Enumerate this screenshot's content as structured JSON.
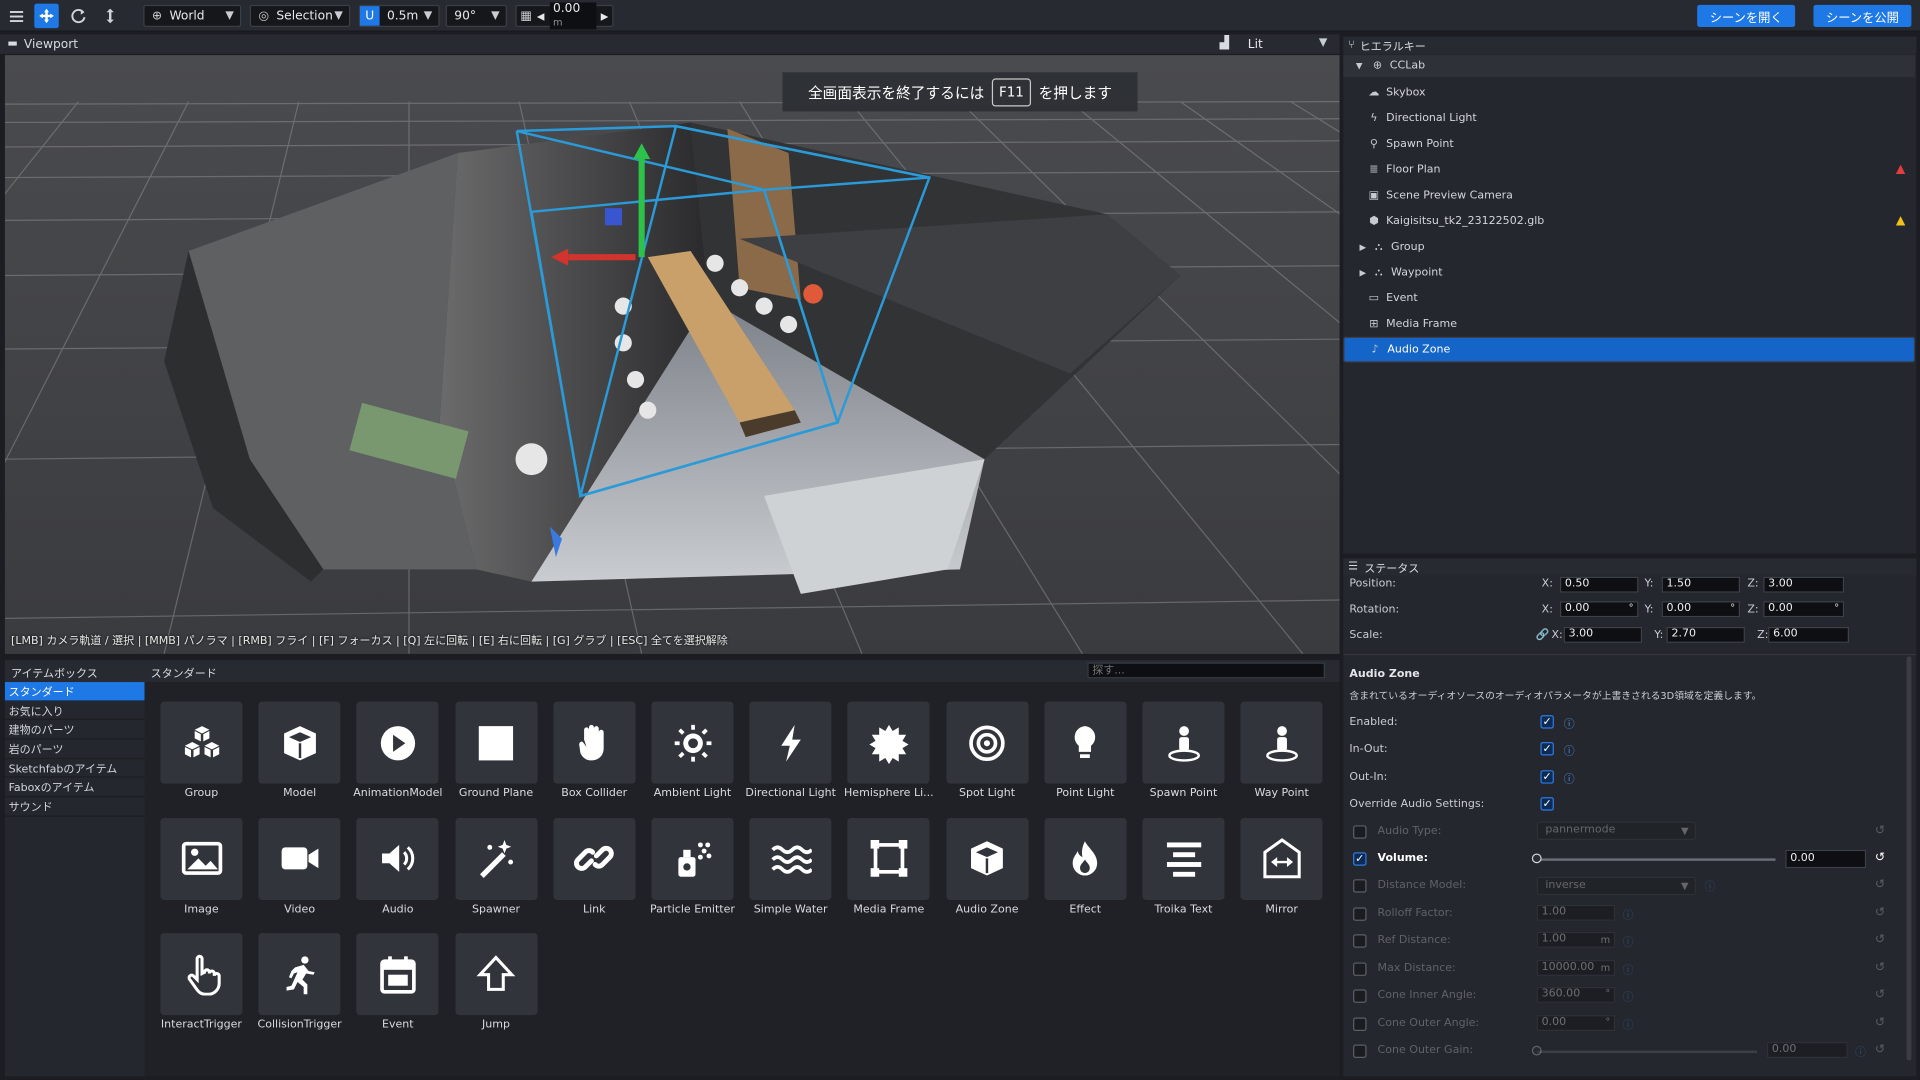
{
  "toolbar": {
    "space": "World",
    "pivot": "Selection",
    "snap": "0.5m",
    "angle": "90°",
    "grid_value": "0.00",
    "grid_unit": "m",
    "open_scene": "シーンを開く",
    "publish_scene": "シーンを公開"
  },
  "viewport": {
    "title": "Viewport",
    "render_mode": "Lit",
    "fullscreen_prefix": "全画面表示を終了するには",
    "fullscreen_key": "F11",
    "fullscreen_suffix": "を押します",
    "hint": "[LMB] カメラ軌道 / 選択 | [MMB] パノラマ | [RMB] フライ | [F] フォーカス | [Q] 左に回転 | [E] 右に回転 | [G] グラブ | [ESC] 全てを選択解除"
  },
  "itembox": {
    "title": "アイテムボックス",
    "section": "スタンダード",
    "search_placeholder": "探す...",
    "categories": [
      "スタンダード",
      "お気に入り",
      "建物のパーツ",
      "岩のパーツ",
      "Sketchfabのアイテム",
      "Faboxのアイテム",
      "サウンド"
    ],
    "items": [
      "Group",
      "Model",
      "AnimationModel",
      "Ground Plane",
      "Box Collider",
      "Ambient Light",
      "Directional Light",
      "Hemisphere Li...",
      "Spot Light",
      "Point Light",
      "Spawn Point",
      "Way Point",
      "Image",
      "Video",
      "Audio",
      "Spawner",
      "Link",
      "Particle Emitter",
      "Simple Water",
      "Media Frame",
      "Audio Zone",
      "Effect",
      "Troika Text",
      "Mirror",
      "InteractTrigger",
      "CollisionTrigger",
      "Event",
      "Jump"
    ]
  },
  "hierarchy": {
    "title": "ヒエラルキー",
    "root": "CCLab",
    "nodes": [
      "Skybox",
      "Directional Light",
      "Spawn Point",
      "Floor Plan",
      "Scene Preview Camera",
      "Kaigisitsu_tk2_23122502.glb",
      "Group",
      "Waypoint",
      "Event",
      "Media Frame",
      "Audio Zone"
    ]
  },
  "status": {
    "title": "ステータス",
    "position_label": "Position:",
    "rotation_label": "Rotation:",
    "scale_label": "Scale:",
    "x": "X:",
    "y": "Y:",
    "z": "Z:",
    "position": [
      "0.50",
      "1.50",
      "3.00"
    ],
    "rotation": [
      "0.00",
      "0.00",
      "0.00"
    ],
    "scale": [
      "3.00",
      "2.70",
      "6.00"
    ],
    "component": "Audio Zone",
    "description": "含まれているオーディオソースのオーディオパラメータが上書きされる3D領域を定義します。",
    "enabled": "Enabled:",
    "in_out": "In-Out:",
    "out_in": "Out-In:",
    "override": "Override Audio Settings:",
    "audio_type": "Audio Type:",
    "audio_type_value": "pannermode",
    "volume": "Volume:",
    "volume_value": "0.00",
    "distance_model": "Distance Model:",
    "distance_model_value": "inverse",
    "rolloff": "Rolloff Factor:",
    "rolloff_value": "1.00",
    "ref_distance": "Ref Distance:",
    "ref_distance_value": "1.00",
    "max_distance": "Max Distance:",
    "max_distance_value": "10000.00",
    "cone_inner": "Cone Inner Angle:",
    "cone_inner_value": "360.00",
    "cone_outer": "Cone Outer Angle:",
    "cone_outer_value": "0.00",
    "cone_outer_gain": "Cone Outer Gain:",
    "cone_outer_gain_value": "0.00",
    "unit_m": "m",
    "unit_deg": "°"
  },
  "colors": {
    "accent": "#1e78e6",
    "panel": "#24272d",
    "warning_red": "#e33d3d",
    "warning_yellow": "#f2c21b"
  }
}
